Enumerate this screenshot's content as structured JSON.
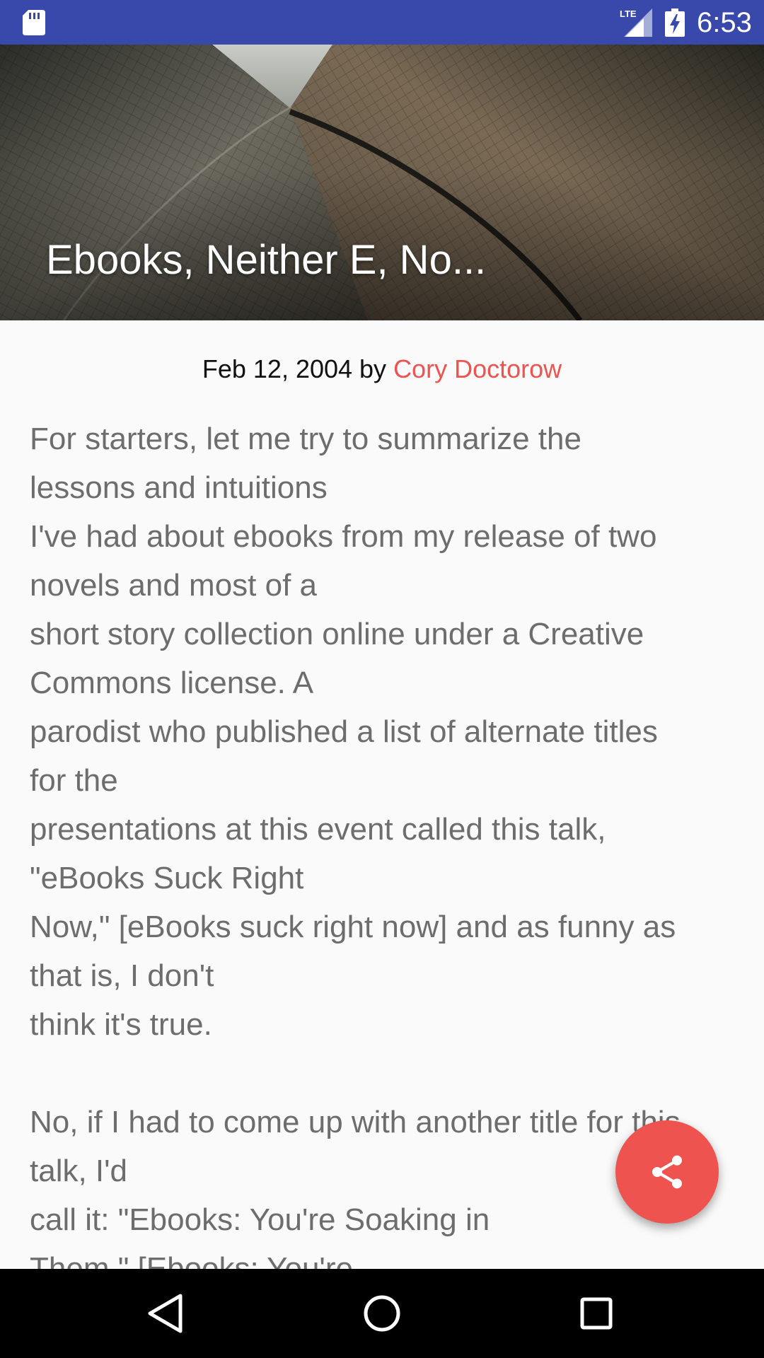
{
  "status_bar": {
    "time": "6:53",
    "network_label": "LTE",
    "icons": [
      "sd-card-icon",
      "lte-signal-icon",
      "battery-charging-icon"
    ],
    "background_color": "#3949ab"
  },
  "header": {
    "title": "Ebooks, Neither E, No..."
  },
  "byline": {
    "date_prefix": "Feb 12, 2004 by ",
    "author": "Cory Doctorow",
    "author_color": "#ef5350"
  },
  "article": {
    "paragraphs": [
      {
        "lines": [
          "For starters, let me try to summarize the",
          "lessons and intuitions",
          "I've had about ebooks from my release of two",
          "novels and most of a",
          "short story collection online under a Creative",
          "Commons license. A",
          "parodist who published a list of alternate titles",
          "for the",
          "presentations at this event called this talk,",
          "\"eBooks Suck Right",
          "Now,\" [eBooks suck right now] and as funny as",
          "that is, I don't",
          "think it's true."
        ]
      },
      {
        "lines": [
          "No, if I had to come up with another title for this",
          "talk, I'd",
          "call it: \"Ebooks: You're Soaking in",
          "Them.\" [Ebooks: You're"
        ]
      }
    ]
  },
  "fab": {
    "icon": "share-icon",
    "color": "#ef5350"
  },
  "nav_bar": {
    "icons": [
      "back-icon",
      "home-icon",
      "recent-apps-icon"
    ]
  }
}
